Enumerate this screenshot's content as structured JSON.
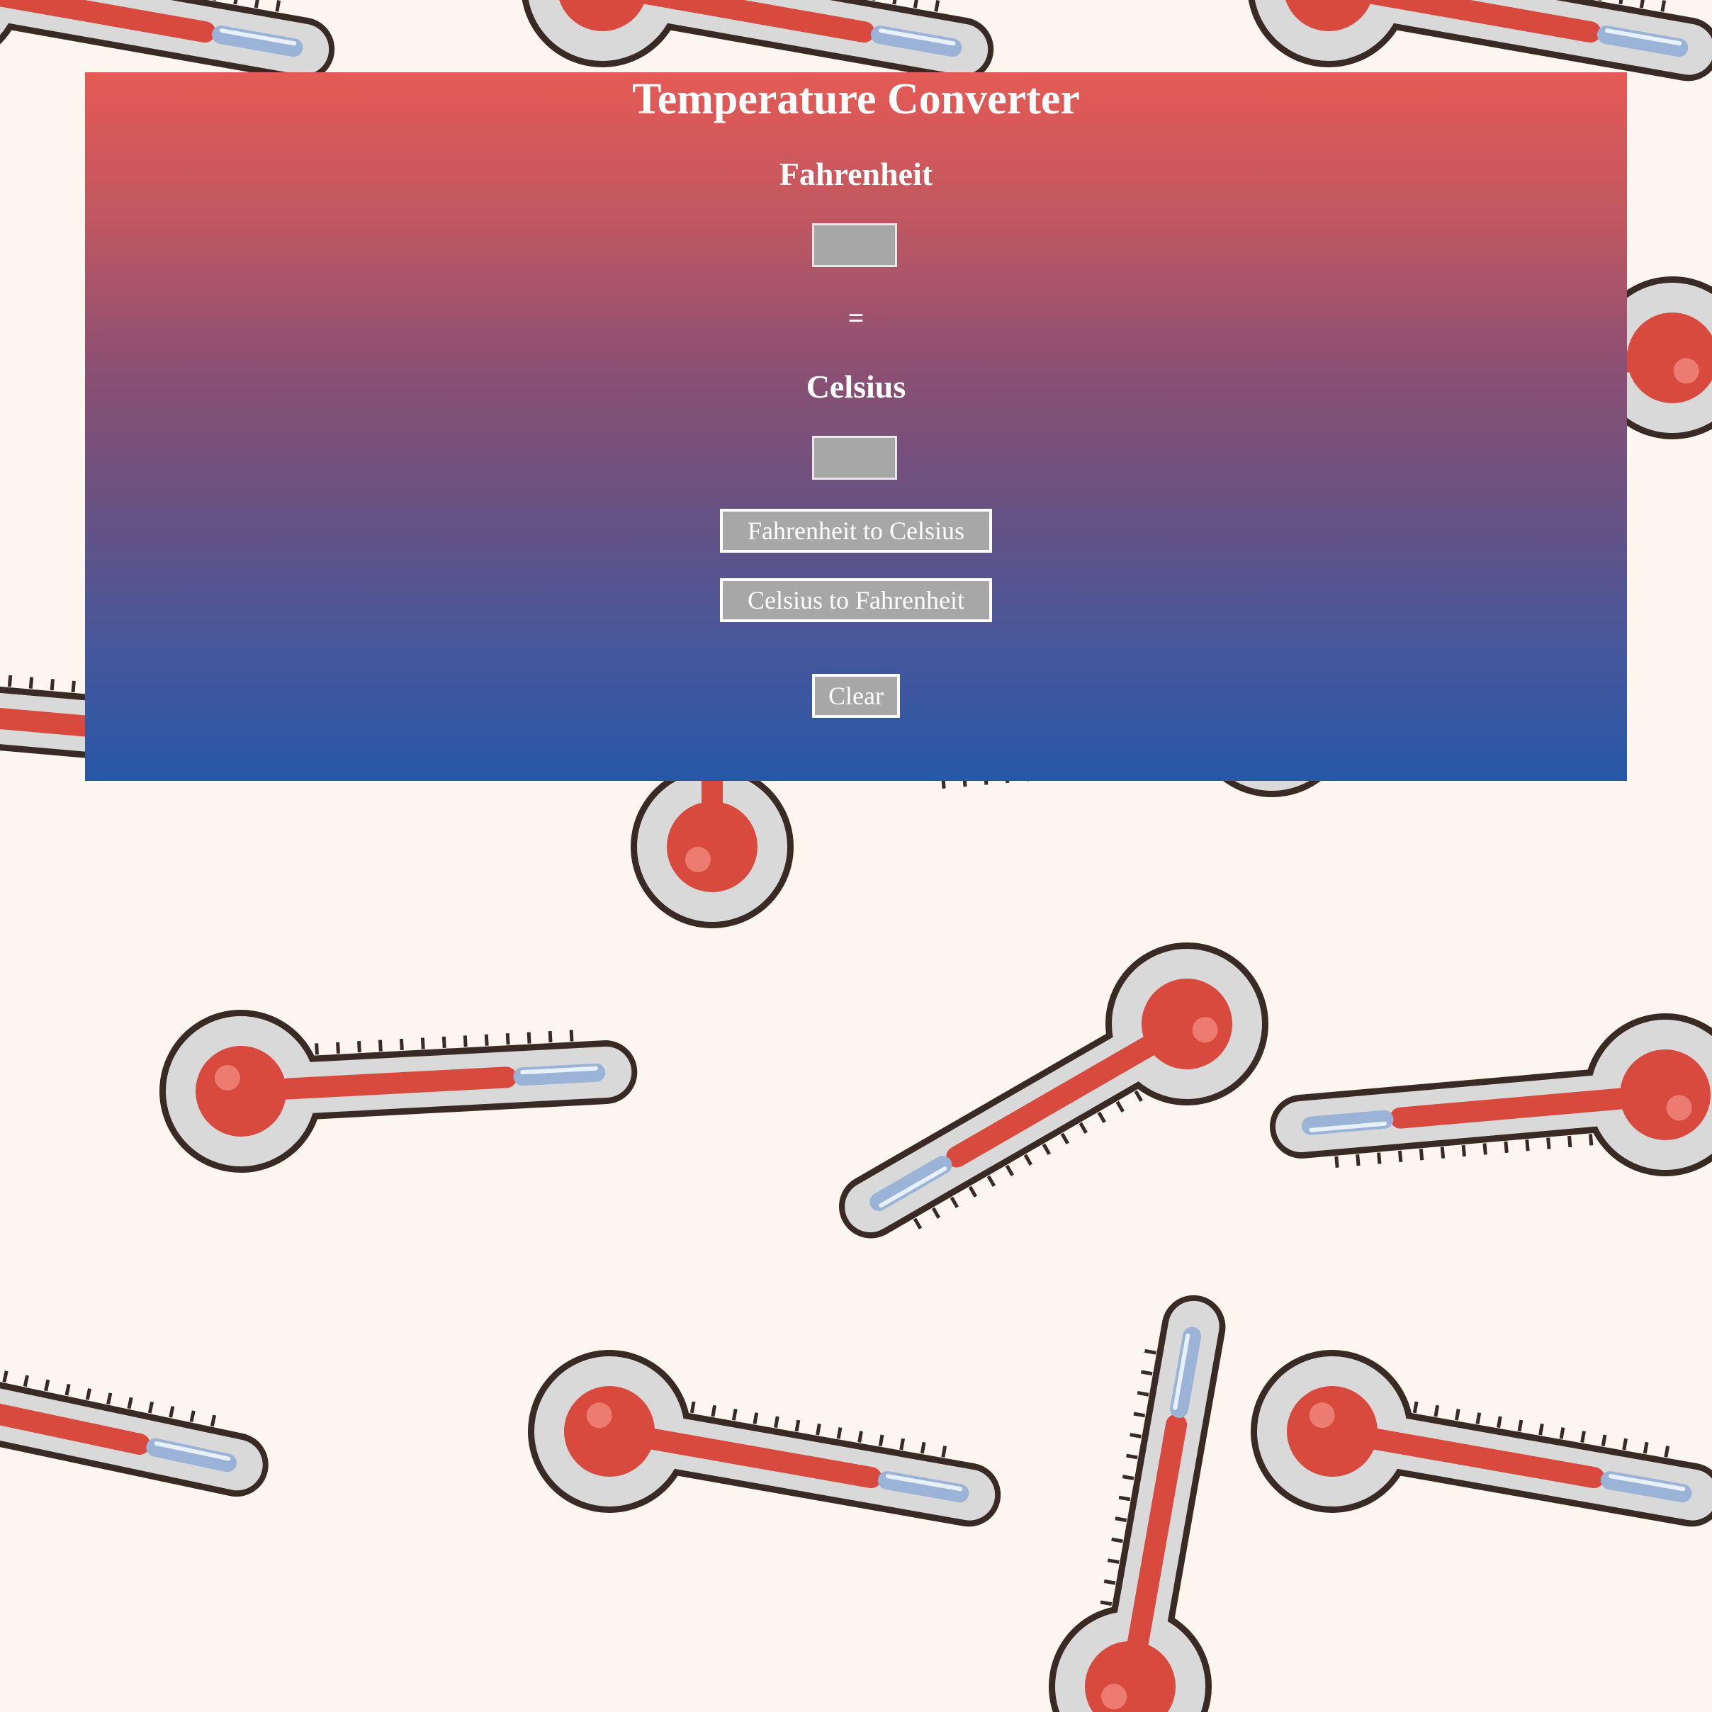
{
  "page": {
    "title": "Temperature Converter"
  },
  "converter": {
    "fahrenheit_label": "Fahrenheit",
    "fahrenheit_value": "",
    "equals_label": "=",
    "celsius_label": "Celsius",
    "celsius_value": "",
    "f_to_c_button": "Fahrenheit to Celsius",
    "c_to_f_button": "Celsius to Fahrenheit",
    "clear_button": "Clear"
  },
  "colors": {
    "gradient_top": "#e55a54",
    "gradient_bottom": "#2757a8",
    "background": "#fdf6ee",
    "field_fill": "#a7a7a7",
    "text": "#ffffff",
    "thermometer_red": "#d84a3e",
    "thermometer_glass": "#d8d8d8",
    "thermometer_outline": "#3a2a24",
    "thermometer_blue": "#9ab3d6"
  },
  "background_pattern": {
    "icon": "thermometer-icon"
  }
}
